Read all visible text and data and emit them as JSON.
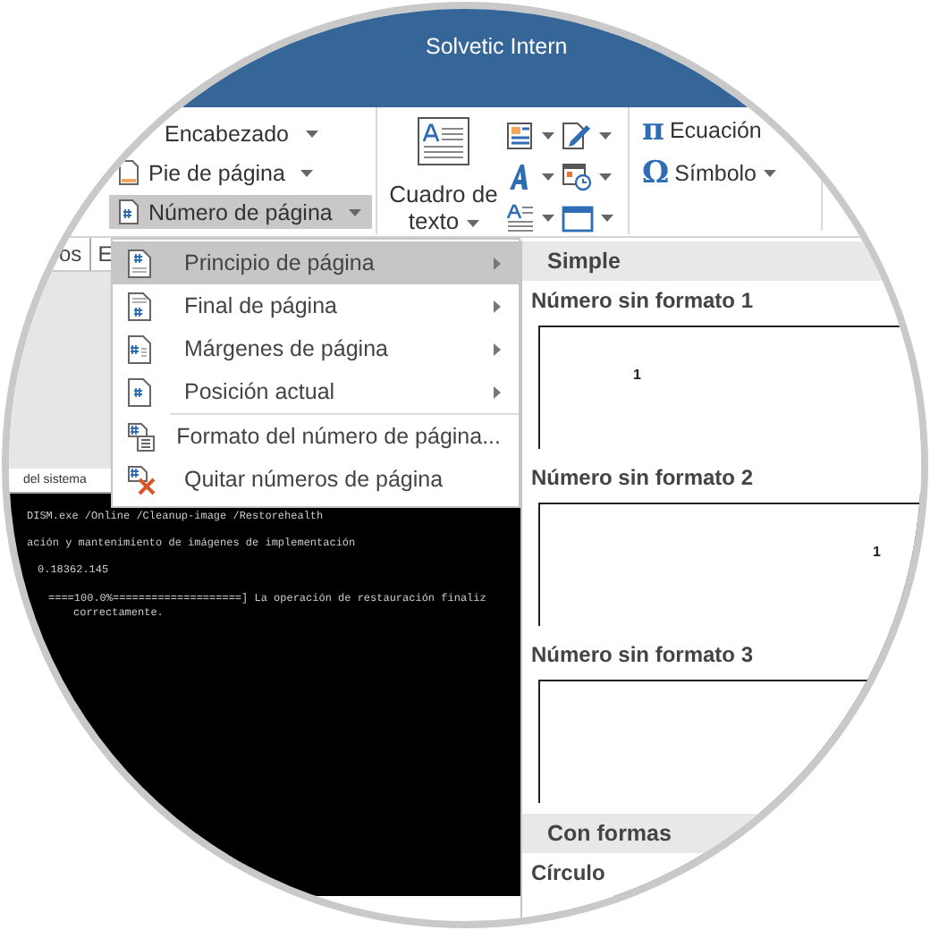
{
  "window": {
    "title": "Solvetic Intern"
  },
  "ribbon": {
    "header_footer": [
      {
        "label": "Encabezado",
        "dropdown": true,
        "selected": false
      },
      {
        "label": "Pie de página",
        "dropdown": true,
        "selected": false
      },
      {
        "label": "Número de página",
        "dropdown": true,
        "selected": true
      }
    ],
    "text_box": {
      "label": "Cuadro de texto",
      "dropdown": true
    },
    "symbols": [
      {
        "symbol": "π",
        "label": "Ecuación",
        "dropdown": false
      },
      {
        "symbol": "Ω",
        "label": "Símbolo",
        "dropdown": true
      }
    ]
  },
  "tab_row": [
    "os",
    "E"
  ],
  "document": {
    "status_label": "del sistema"
  },
  "console": {
    "lines": [
      "DISM.exe /Online /Cleanup-image /Restorehealth",
      "ación y mantenimiento de imágenes de implementación",
      "0.18362.145",
      "====100.0%====================] La operación de restauración finaliz",
      "correctamente."
    ]
  },
  "page_menu": {
    "items": [
      {
        "label": "Principio de página",
        "selected": true,
        "submenu": true,
        "separator_before": false
      },
      {
        "label": "Final de página",
        "selected": false,
        "submenu": true,
        "separator_before": false
      },
      {
        "label": "Márgenes de página",
        "selected": false,
        "submenu": true,
        "separator_before": false
      },
      {
        "label": "Posición actual",
        "selected": false,
        "submenu": true,
        "separator_before": false
      },
      {
        "label": "Formato del número de página...",
        "selected": false,
        "submenu": false,
        "separator_before": true
      },
      {
        "label": "Quitar números de página",
        "selected": false,
        "submenu": false,
        "separator_before": false
      }
    ]
  },
  "gallery": {
    "sections": [
      {
        "header": "Simple",
        "items": [
          {
            "label": "Número sin formato 1",
            "number": "1"
          },
          {
            "label": "Número sin formato 2",
            "number": "1"
          },
          {
            "label": "Número sin formato 3"
          }
        ]
      },
      {
        "header": "Con formas",
        "items": [
          {
            "label": "Círculo"
          }
        ]
      }
    ]
  }
}
